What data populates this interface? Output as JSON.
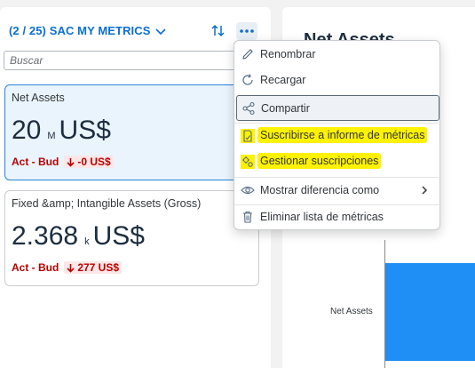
{
  "left_panel": {
    "title": "(2 / 25) SAC MY METRICS",
    "search_placeholder": "Buscar",
    "cards": [
      {
        "title": "Net Assets",
        "value": "20",
        "scale": "M",
        "unit": "US$",
        "variance_label": "Act - Bud",
        "variance_value": "-0 US$",
        "variance_direction": "down",
        "selected": true
      },
      {
        "title": "Fixed &amp; Intangible Assets (Gross)",
        "value": "2.368",
        "scale": "k",
        "unit": "US$",
        "variance_label": "Act - Bud",
        "variance_value": "277 US$",
        "variance_direction": "down",
        "selected": false
      }
    ]
  },
  "right_panel": {
    "title": "Net Assets",
    "chart_category": "Net Assets"
  },
  "context_menu": {
    "items": [
      {
        "label": "Renombrar",
        "icon": "pencil-icon"
      },
      {
        "label": "Recargar",
        "icon": "refresh-icon"
      },
      {
        "label": "Compartir",
        "icon": "share-icon",
        "focused": true
      },
      {
        "label": "Suscribirse a informe de métricas",
        "icon": "subscribe-report-icon",
        "highlighted": true
      },
      {
        "label": "Gestionar suscripciones",
        "icon": "manage-subscriptions-icon",
        "highlighted": true
      },
      {
        "label": "Mostrar diferencia como",
        "icon": "eye-icon",
        "has_submenu": true
      },
      {
        "label": "Eliminar lista de métricas",
        "icon": "trash-icon"
      }
    ]
  },
  "colors": {
    "accent": "#0a6ed1",
    "negative": "#bb0000",
    "highlight": "#fff200",
    "bar": "#1f8ff5"
  }
}
